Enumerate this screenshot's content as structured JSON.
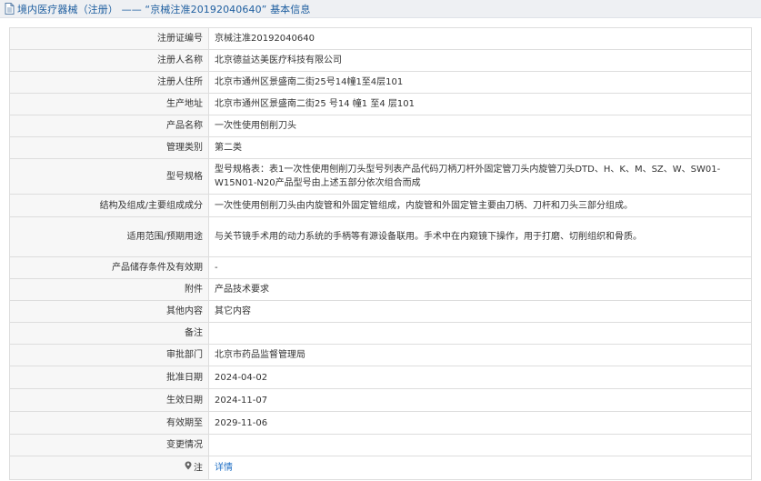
{
  "header": {
    "title": "境内医疗器械（注册） —— “京械注准20192040640” 基本信息"
  },
  "rows": [
    {
      "label": "注册证编号",
      "value": "京械注准20192040640"
    },
    {
      "label": "注册人名称",
      "value": "北京德益达美医疗科技有限公司"
    },
    {
      "label": "注册人住所",
      "value": "北京市通州区景盛南二街25号14幢1至4层101"
    },
    {
      "label": "生产地址",
      "value": "北京市通州区景盛南二街25 号14 幢1 至4 层101"
    },
    {
      "label": "产品名称",
      "value": "一次性使用刨削刀头"
    },
    {
      "label": "管理类别",
      "value": "第二类"
    },
    {
      "label": "型号规格",
      "value": "型号规格表：表1一次性使用刨削刀头型号列表产品代码刀柄刀杆外固定管刀头内旋管刀头DTD、H、K、M、SZ、W、SW01-W15N01-N20产品型号由上述五部分依次组合而成"
    },
    {
      "label": "结构及组成/主要组成成分",
      "value": "一次性使用刨削刀头由内旋管和外固定管组成，内旋管和外固定管主要由刀柄、刀杆和刀头三部分组成。"
    },
    {
      "label": "适用范围/预期用途",
      "value": "与关节镜手术用的动力系统的手柄等有源设备联用。手术中在内窥镜下操作，用于打磨、切削组织和骨质。"
    },
    {
      "label": "产品储存条件及有效期",
      "value": "-"
    },
    {
      "label": "附件",
      "value": "产品技术要求"
    },
    {
      "label": "其他内容",
      "value": "其它内容"
    },
    {
      "label": "备注",
      "value": ""
    },
    {
      "label": "审批部门",
      "value": "北京市药品监督管理局"
    },
    {
      "label": "批准日期",
      "value": "2024-04-02"
    },
    {
      "label": "生效日期",
      "value": "2024-11-07"
    },
    {
      "label": "有效期至",
      "value": "2029-11-06"
    },
    {
      "label": "变更情况",
      "value": ""
    },
    {
      "label": "注",
      "value": "详情"
    }
  ],
  "colors": {
    "header_bg": "#eef0f3",
    "header_text": "#1f5fa0",
    "label_bg": "#f7f7f7",
    "border": "#dddddd",
    "link": "#1f6fc5"
  },
  "icons": {
    "header": "document-icon",
    "note": "location-pin-icon"
  }
}
